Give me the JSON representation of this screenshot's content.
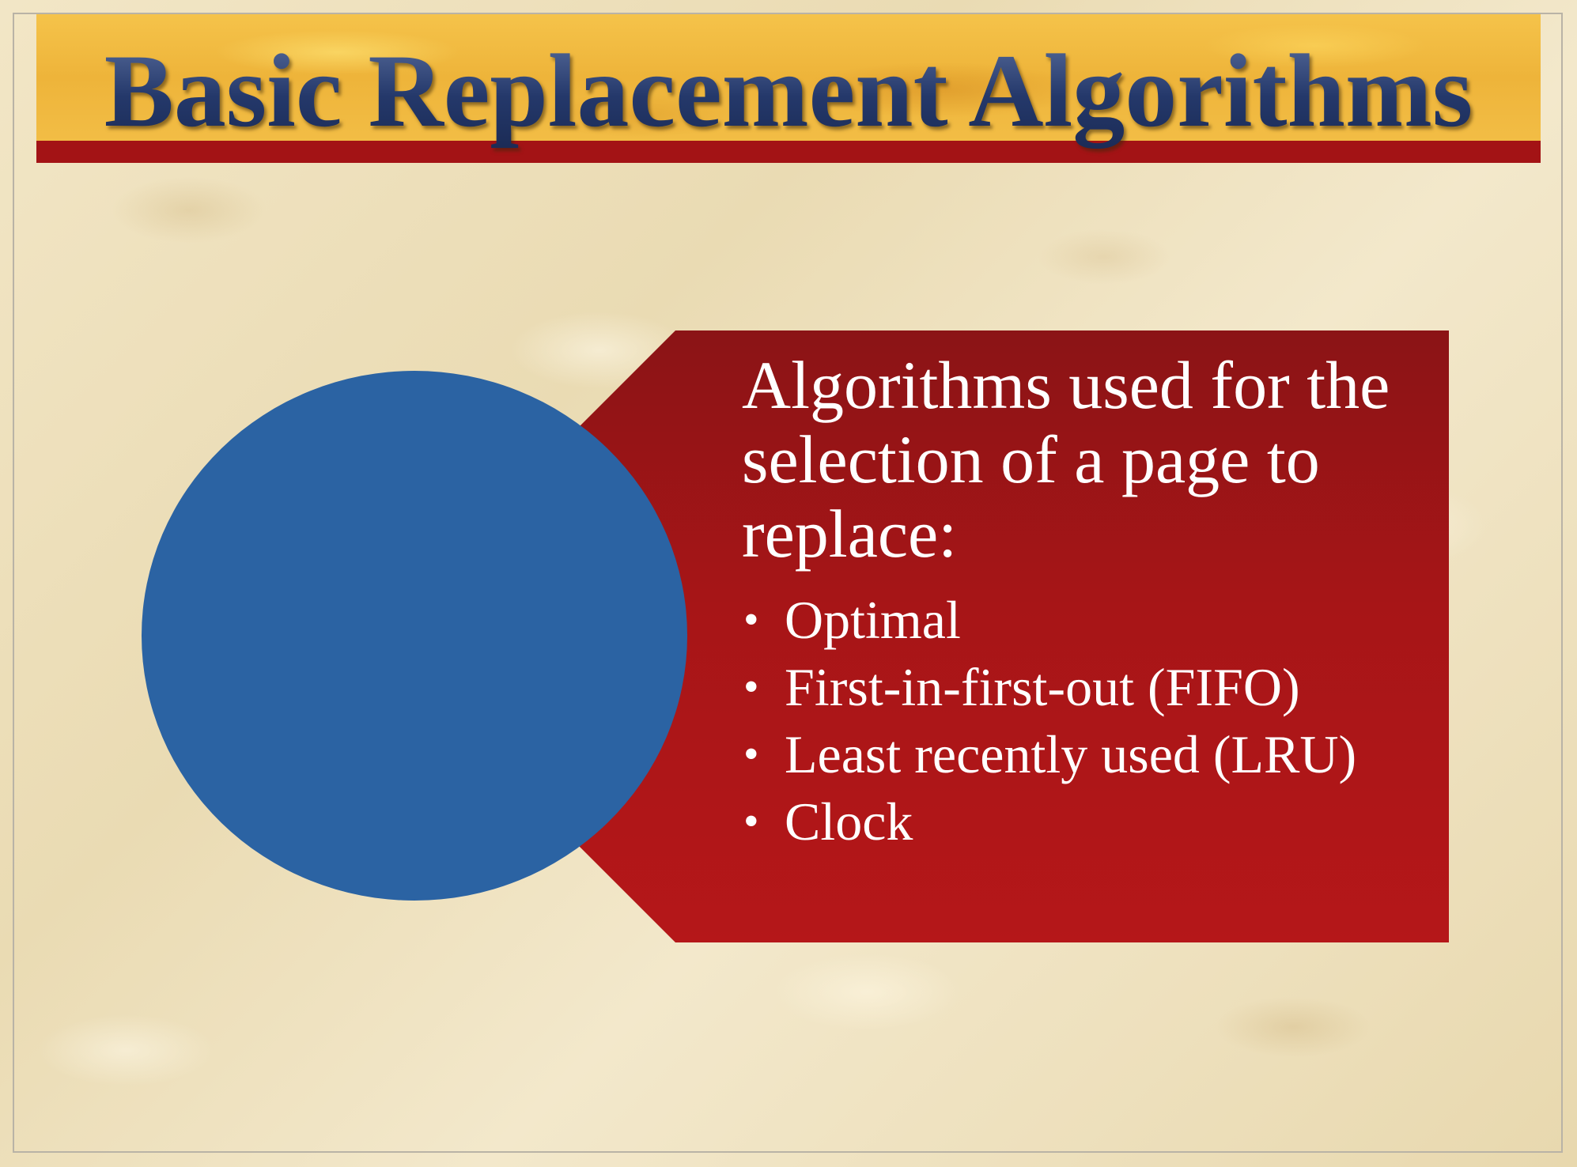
{
  "slide": {
    "title": "Basic Replacement Algorithms",
    "content": {
      "heading": "Algorithms used for the selection of a page to replace:",
      "bullets": [
        "Optimal",
        "First-in-first-out (FIFO)",
        "Least recently used (LRU)",
        "Clock"
      ]
    },
    "colors": {
      "title_band": "#f0b840",
      "title_underline": "#a31315",
      "title_text": "#24386a",
      "content_box": "#b01518",
      "circle": "#2b63a3",
      "background": "#efe2bf"
    },
    "icons": {
      "bullet": "•"
    }
  }
}
